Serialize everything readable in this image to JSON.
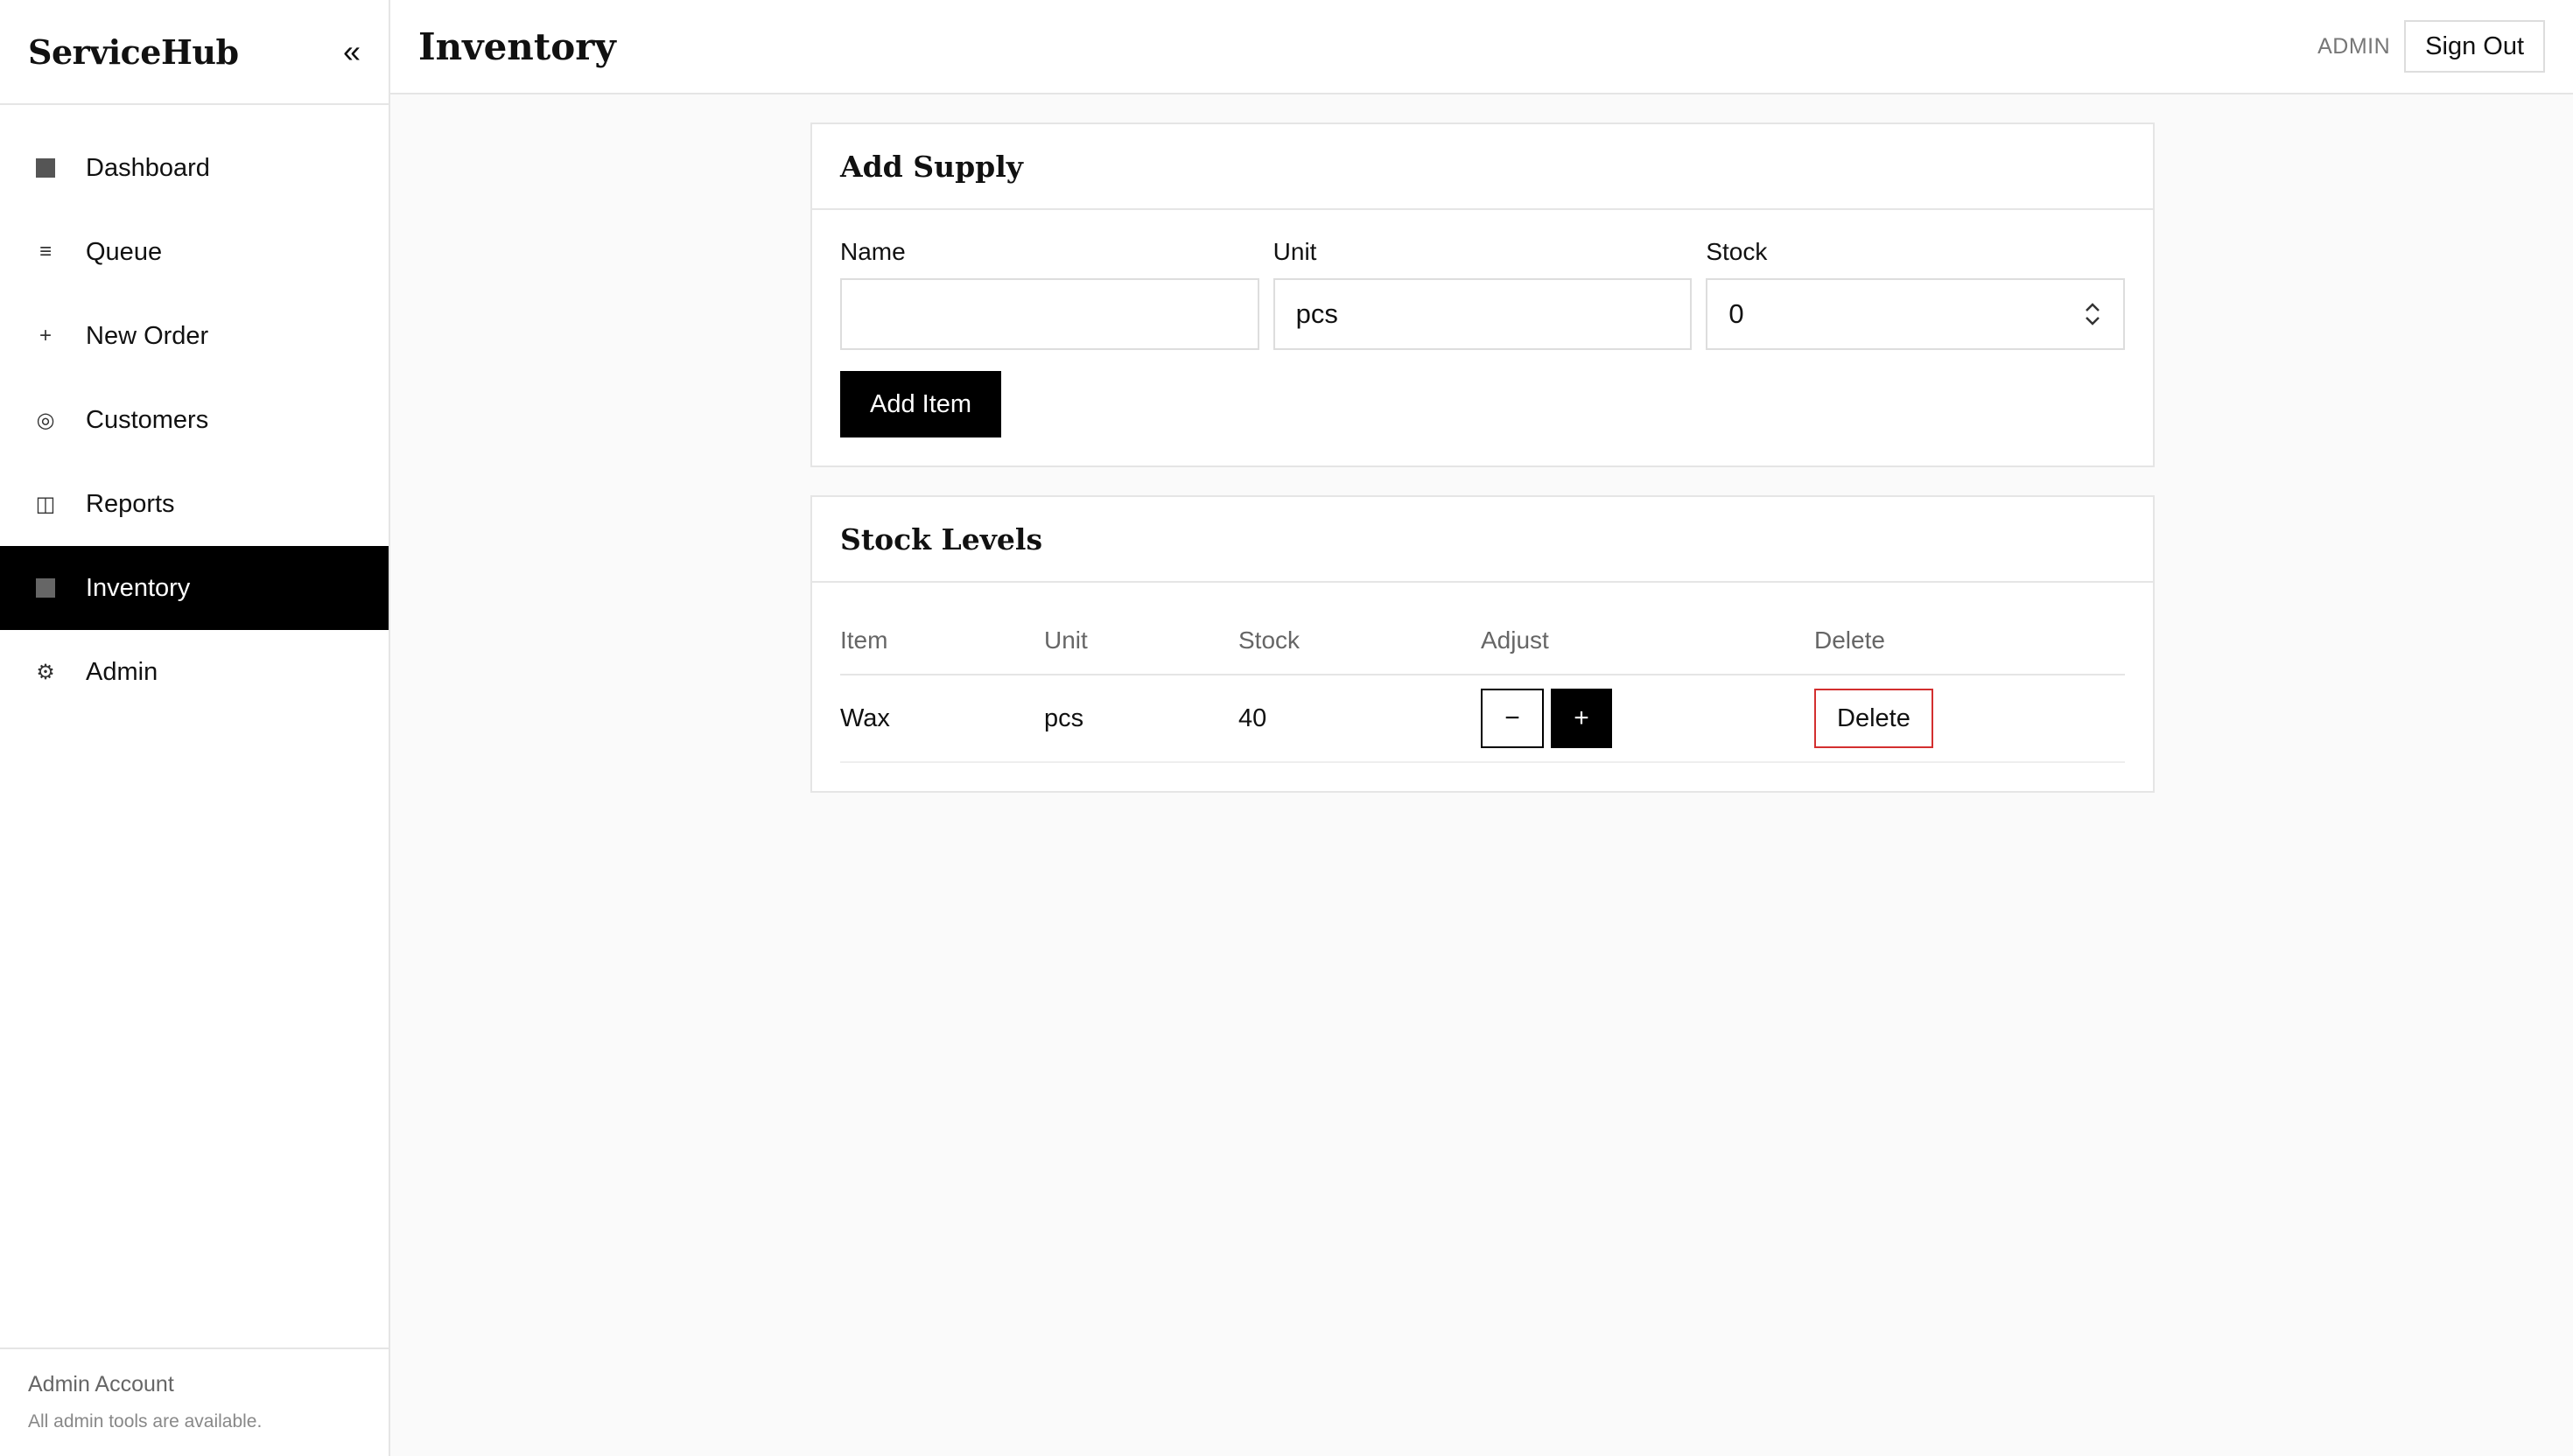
{
  "sidebar": {
    "brand": "ServiceHub",
    "collapse_glyph": "«",
    "items": [
      {
        "label": "Dashboard",
        "icon": "square-icon",
        "glyph": ""
      },
      {
        "label": "Queue",
        "icon": "menu-icon",
        "glyph": "≡"
      },
      {
        "label": "New Order",
        "icon": "plus-icon",
        "glyph": "+"
      },
      {
        "label": "Customers",
        "icon": "circle-icon",
        "glyph": "◎"
      },
      {
        "label": "Reports",
        "icon": "columns-icon",
        "glyph": "◫"
      },
      {
        "label": "Inventory",
        "icon": "square-icon",
        "glyph": "",
        "active": true
      },
      {
        "label": "Admin",
        "icon": "gear-icon",
        "glyph": "⚙"
      }
    ],
    "footer": {
      "title": "Admin Account",
      "subtitle": "All admin tools are available."
    }
  },
  "topbar": {
    "title": "Inventory",
    "role": "ADMIN",
    "signout_label": "Sign Out"
  },
  "add_supply": {
    "title": "Add Supply",
    "name_label": "Name",
    "name_value": "",
    "unit_label": "Unit",
    "unit_value": "pcs",
    "stock_label": "Stock",
    "stock_value": "0",
    "add_label": "Add Item"
  },
  "stock_levels": {
    "title": "Stock Levels",
    "columns": [
      "Item",
      "Unit",
      "Stock",
      "Adjust",
      "Delete"
    ],
    "rows": [
      {
        "item": "Wax",
        "unit": "pcs",
        "stock": "40",
        "minus": "−",
        "plus": "+",
        "delete": "Delete"
      }
    ]
  },
  "colors": {
    "accent": "#000000",
    "danger": "#d32f2f",
    "border": "#e5e5e5"
  }
}
